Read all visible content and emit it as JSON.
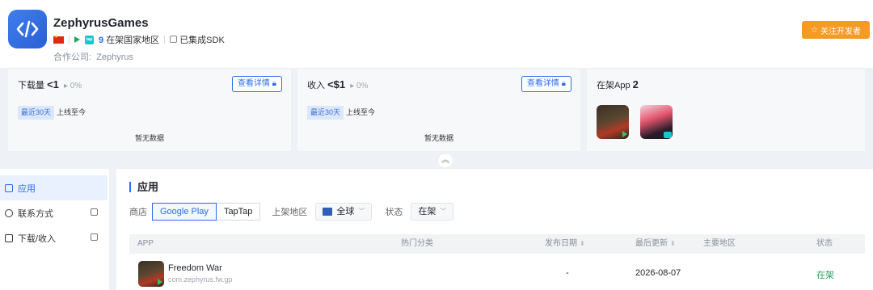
{
  "developer": {
    "name": "ZephyrusGames",
    "country_count": "9",
    "country_text": "在架国家地区",
    "sdk_text": "已集成SDK",
    "partner_label": "合作公司:",
    "partner_name": "Zephyrus",
    "follow_label": "关注开发者",
    "store_badges": [
      "google-play-icon",
      "taptap-icon"
    ],
    "tap_badge_text": "tap"
  },
  "stats": {
    "downloads": {
      "label": "下载量",
      "value": "<1",
      "change": "0%",
      "detail_label": "查看详情",
      "range_active": "最近30天",
      "range_alt": "上线至今",
      "empty_text": "暂无数据"
    },
    "revenue": {
      "label": "收入",
      "value": "<$1",
      "change": "0%",
      "detail_label": "查看详情",
      "range_active": "最近30天",
      "range_alt": "上线至今",
      "empty_text": "暂无数据"
    },
    "apps": {
      "label": "在架App",
      "value": "2"
    }
  },
  "sidebar": {
    "items": [
      {
        "label": "应用",
        "locked": false
      },
      {
        "label": "联系方式",
        "locked": true
      },
      {
        "label": "下载/收入",
        "locked": true
      }
    ]
  },
  "main": {
    "section_title": "应用",
    "filters": {
      "store_label": "商店",
      "store_options": [
        "Google Play",
        "TapTap"
      ],
      "store_selected": "Google Play",
      "region_label": "上架地区",
      "region_value": "全球",
      "status_label": "状态",
      "status_value": "在架"
    },
    "table": {
      "headers": [
        "APP",
        "热门分类",
        "发布日期",
        "最后更新",
        "主要地区",
        "状态"
      ],
      "rows": [
        {
          "name": "Freedom War",
          "package": "com.zephyrus.fw.gp",
          "category": "",
          "release_date": "-",
          "last_update": "2026-08-07",
          "region": "",
          "status": "在架"
        }
      ]
    }
  },
  "colors": {
    "accent": "#2b6cf0",
    "follow": "#f59a23",
    "status_ok": "#21a35a"
  }
}
